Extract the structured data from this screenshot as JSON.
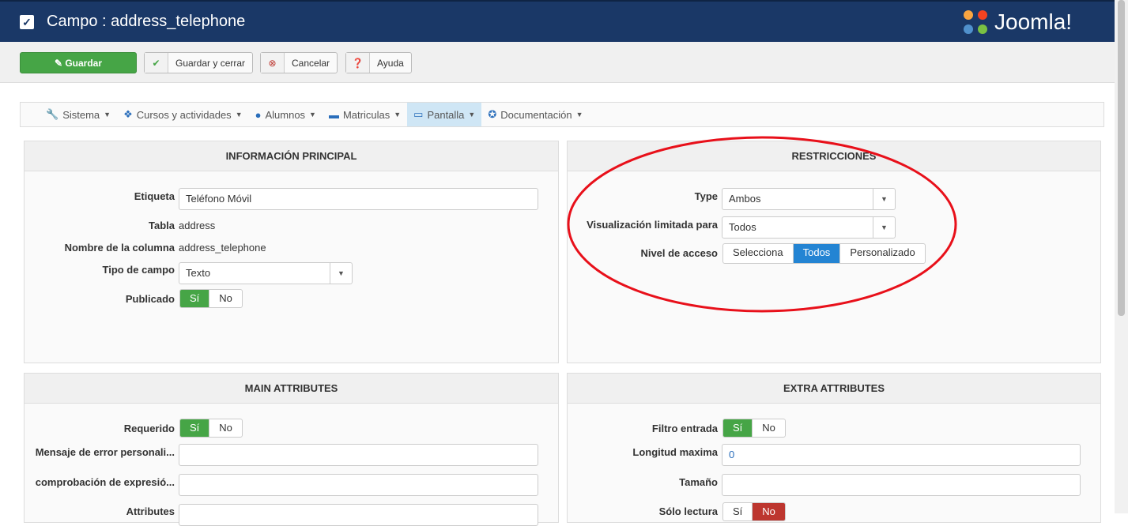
{
  "header": {
    "title": "Campo : address_telephone",
    "logo": "Joomla!"
  },
  "toolbar": {
    "save": "Guardar",
    "save_close": "Guardar y cerrar",
    "cancel": "Cancelar",
    "help": "Ayuda"
  },
  "menu": [
    {
      "label": "Sistema",
      "icon": "wrench-icon"
    },
    {
      "label": "Cursos y actividades",
      "icon": "cubes-icon"
    },
    {
      "label": "Alumnos",
      "icon": "user-icon"
    },
    {
      "label": "Matriculas",
      "icon": "credit-card-icon"
    },
    {
      "label": "Pantalla",
      "icon": "monitor-icon"
    },
    {
      "label": "Documentación",
      "icon": "lifebuoy-icon"
    }
  ],
  "info": {
    "title": "INFORMACIÓN PRINCIPAL",
    "etiqueta_label": "Etiqueta",
    "etiqueta_value": "Teléfono Móvil",
    "tabla_label": "Tabla",
    "tabla_value": "address",
    "columna_label": "Nombre de la columna",
    "columna_value": "address_telephone",
    "tipo_label": "Tipo de campo",
    "tipo_value": "Texto",
    "publicado_label": "Publicado",
    "yes": "Sí",
    "no": "No"
  },
  "restr": {
    "title": "RESTRICCIONES",
    "type_label": "Type",
    "type_value": "Ambos",
    "vis_label": "Visualización limitada para",
    "vis_value": "Todos",
    "nivel_label": "Nivel de acceso",
    "opt1": "Selecciona",
    "opt2": "Todos",
    "opt3": "Personalizado"
  },
  "main": {
    "title": "MAIN ATTRIBUTES",
    "req_label": "Requerido",
    "msg_label": "Mensaje de error personali...",
    "regex_label": "comprobación de expresió...",
    "attr_label": "Attributes"
  },
  "extra": {
    "title": "EXTRA ATTRIBUTES",
    "filtro_label": "Filtro entrada",
    "long_label": "Longitud maxima",
    "long_value": "0",
    "tam_label": "Tamaño",
    "ro_label": "Sólo lectura"
  }
}
